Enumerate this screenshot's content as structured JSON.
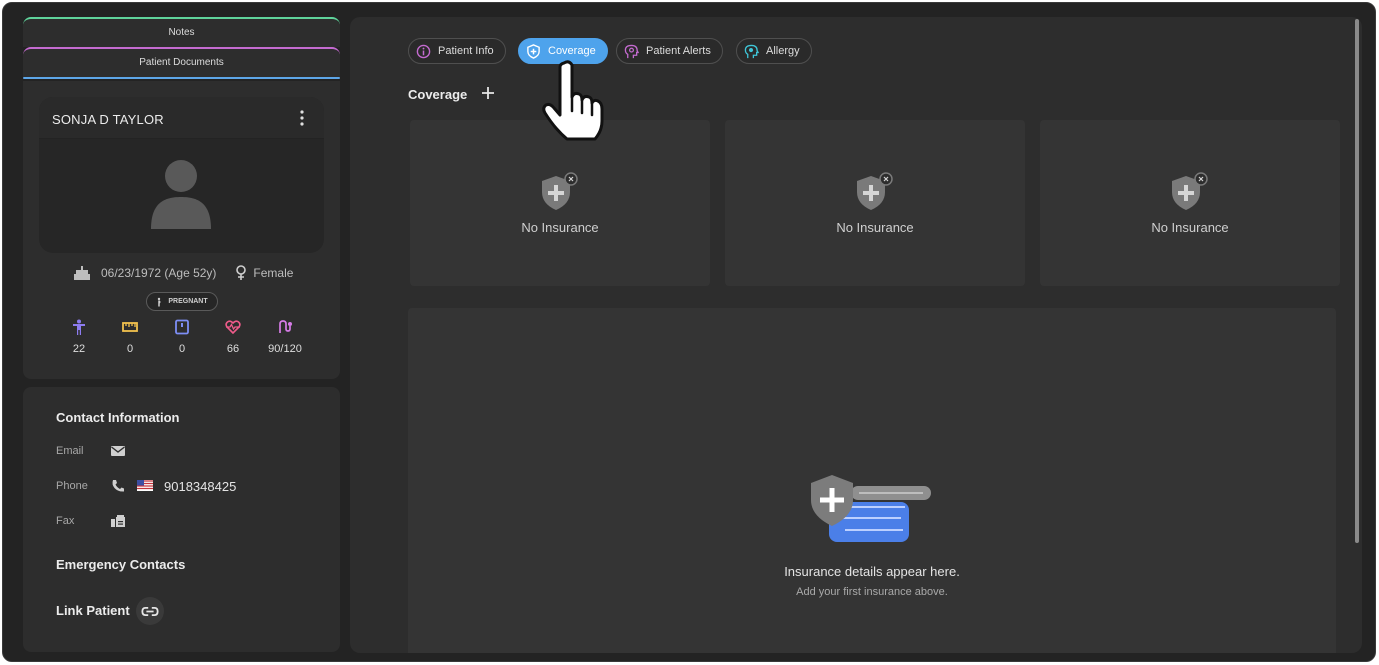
{
  "sidebar": {
    "tabs": [
      "Notes",
      "Patient Documents"
    ],
    "patient": {
      "name": "SONJA D TAYLOR",
      "dob": "06/23/1972 (Age 52y)",
      "gender": "Female",
      "status_badge": "PREGNANT",
      "vitals": [
        {
          "icon": "body-icon",
          "value": "22",
          "color": "#8d7cf0"
        },
        {
          "icon": "ruler-icon",
          "value": "0",
          "color": "#f2c14e"
        },
        {
          "icon": "scale-icon",
          "value": "0",
          "color": "#7d8ef5"
        },
        {
          "icon": "heartbeat-icon",
          "value": "66",
          "color": "#ef5b8a"
        },
        {
          "icon": "blood-pressure-icon",
          "value": "90/120",
          "color": "#d57be6"
        }
      ]
    },
    "contact": {
      "title": "Contact Information",
      "email_label": "Email",
      "phone_label": "Phone",
      "phone_number": "9018348425",
      "fax_label": "Fax",
      "emergency_title": "Emergency Contacts",
      "link_patient_label": "Link Patient"
    }
  },
  "main": {
    "tabs": [
      {
        "label": "Patient Info",
        "icon": "info-icon",
        "active": false
      },
      {
        "label": "Coverage",
        "icon": "shield-icon",
        "active": true
      },
      {
        "label": "Patient Alerts",
        "icon": "alert-brain-icon",
        "active": false
      },
      {
        "label": "Allergy",
        "icon": "allergy-head-icon",
        "active": false
      }
    ],
    "coverage_title": "Coverage",
    "insurance_cards": [
      "No Insurance",
      "No Insurance",
      "No Insurance"
    ],
    "empty_state": {
      "title": "Insurance details appear here.",
      "subtitle": "Add your first insurance above."
    }
  },
  "colors": {
    "accent": "#4ea3ec",
    "background": "#232323",
    "panel": "#2d2d2d"
  }
}
